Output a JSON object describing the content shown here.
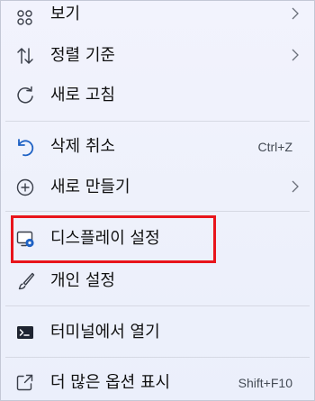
{
  "menu": {
    "items": [
      {
        "label": "보기",
        "icon": "view-grid-icon",
        "has_submenu": true
      },
      {
        "label": "정렬 기준",
        "icon": "sort-arrows-icon",
        "has_submenu": true
      },
      {
        "label": "새로 고침",
        "icon": "refresh-icon",
        "has_submenu": false
      },
      {
        "label": "삭제 취소",
        "icon": "undo-icon",
        "shortcut": "Ctrl+Z"
      },
      {
        "label": "새로 만들기",
        "icon": "new-plus-icon",
        "has_submenu": true
      },
      {
        "label": "디스플레이 설정",
        "icon": "display-settings-icon",
        "highlighted": true
      },
      {
        "label": "개인 설정",
        "icon": "personalize-brush-icon"
      },
      {
        "label": "터미널에서 열기",
        "icon": "terminal-icon"
      },
      {
        "label": "더 많은 옵션 표시",
        "icon": "more-options-icon",
        "shortcut": "Shift+F10"
      }
    ],
    "submenu_arrow": "›"
  },
  "colors": {
    "accent_blue": "#1f62c4",
    "highlight_border": "#e8151b",
    "menu_bg": "#eef1fb"
  }
}
